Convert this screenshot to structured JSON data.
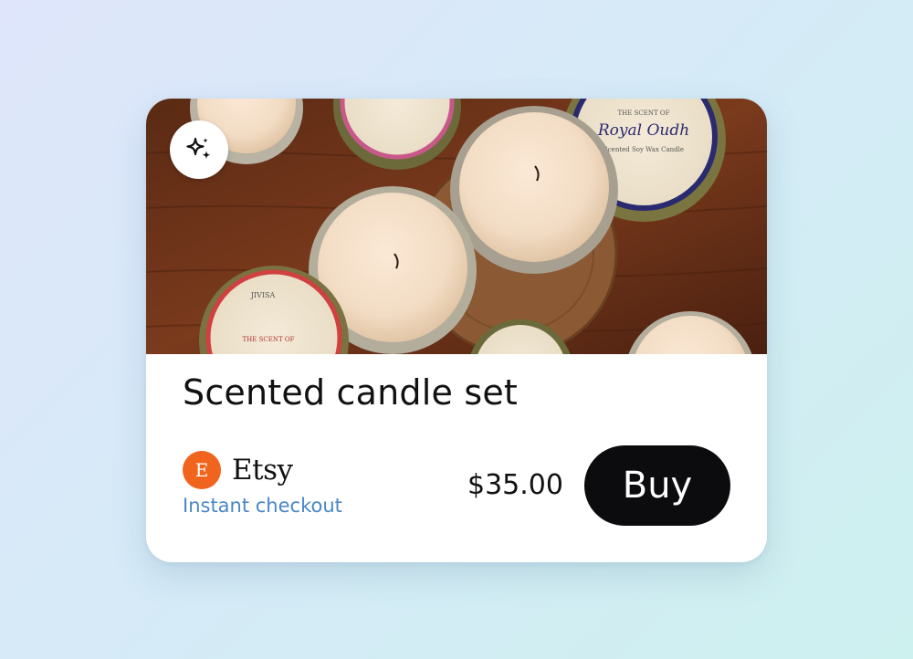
{
  "product": {
    "title": "Scented candle set",
    "image_alt": "Candle tins on a wooden table",
    "image_labels": {
      "brand_left": "JIVISA",
      "scent_label_left": "THE SCENT OF",
      "scent_label_right": "THE SCENT OF",
      "scent_name_right": "Royal Oudh",
      "scent_sub_right": "Scented Soy Wax Candle"
    }
  },
  "badge": {
    "icon": "sparkles-icon"
  },
  "merchant": {
    "logo_letter": "E",
    "name": "Etsy",
    "checkout_text": "Instant checkout",
    "brand_color": "#f1641e"
  },
  "price": "$35.00",
  "buy_button": {
    "label": "Buy"
  },
  "colors": {
    "link": "#4a86c8",
    "button_bg": "#0c0b0e"
  }
}
